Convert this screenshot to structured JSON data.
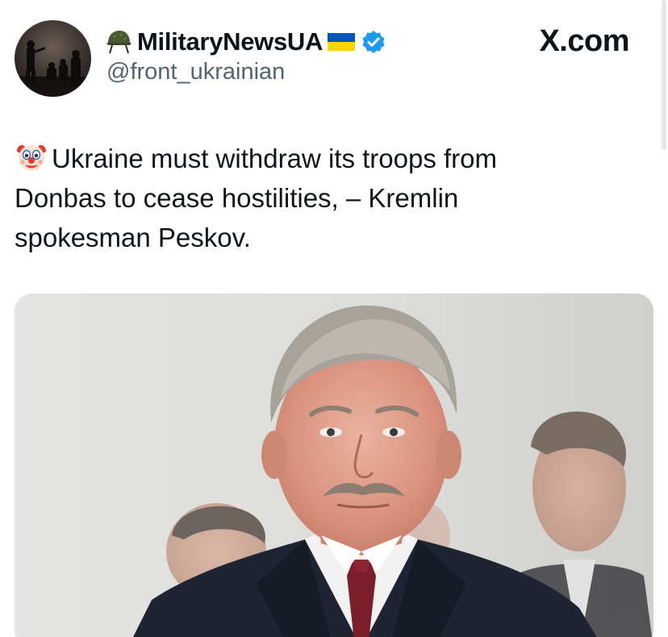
{
  "author": {
    "display_name": "MilitaryNewsUA",
    "handle": "@front_ukrainian",
    "verified": true,
    "name_emoji_before": "helmet-icon",
    "name_emoji_after": "ukraine-flag-icon"
  },
  "site": {
    "label": "X.com"
  },
  "tweet": {
    "emoji": "clown-face-icon",
    "lines": [
      "Ukraine must withdraw its troops from",
      "Donbas to cease hostilities, – Kremlin",
      "spokesman Peskov."
    ]
  },
  "colors": {
    "text": "#0f1419",
    "handle": "#536471",
    "verified": "#1d9bf0",
    "flag_blue": "#0057b7",
    "flag_yellow": "#ffd700"
  }
}
